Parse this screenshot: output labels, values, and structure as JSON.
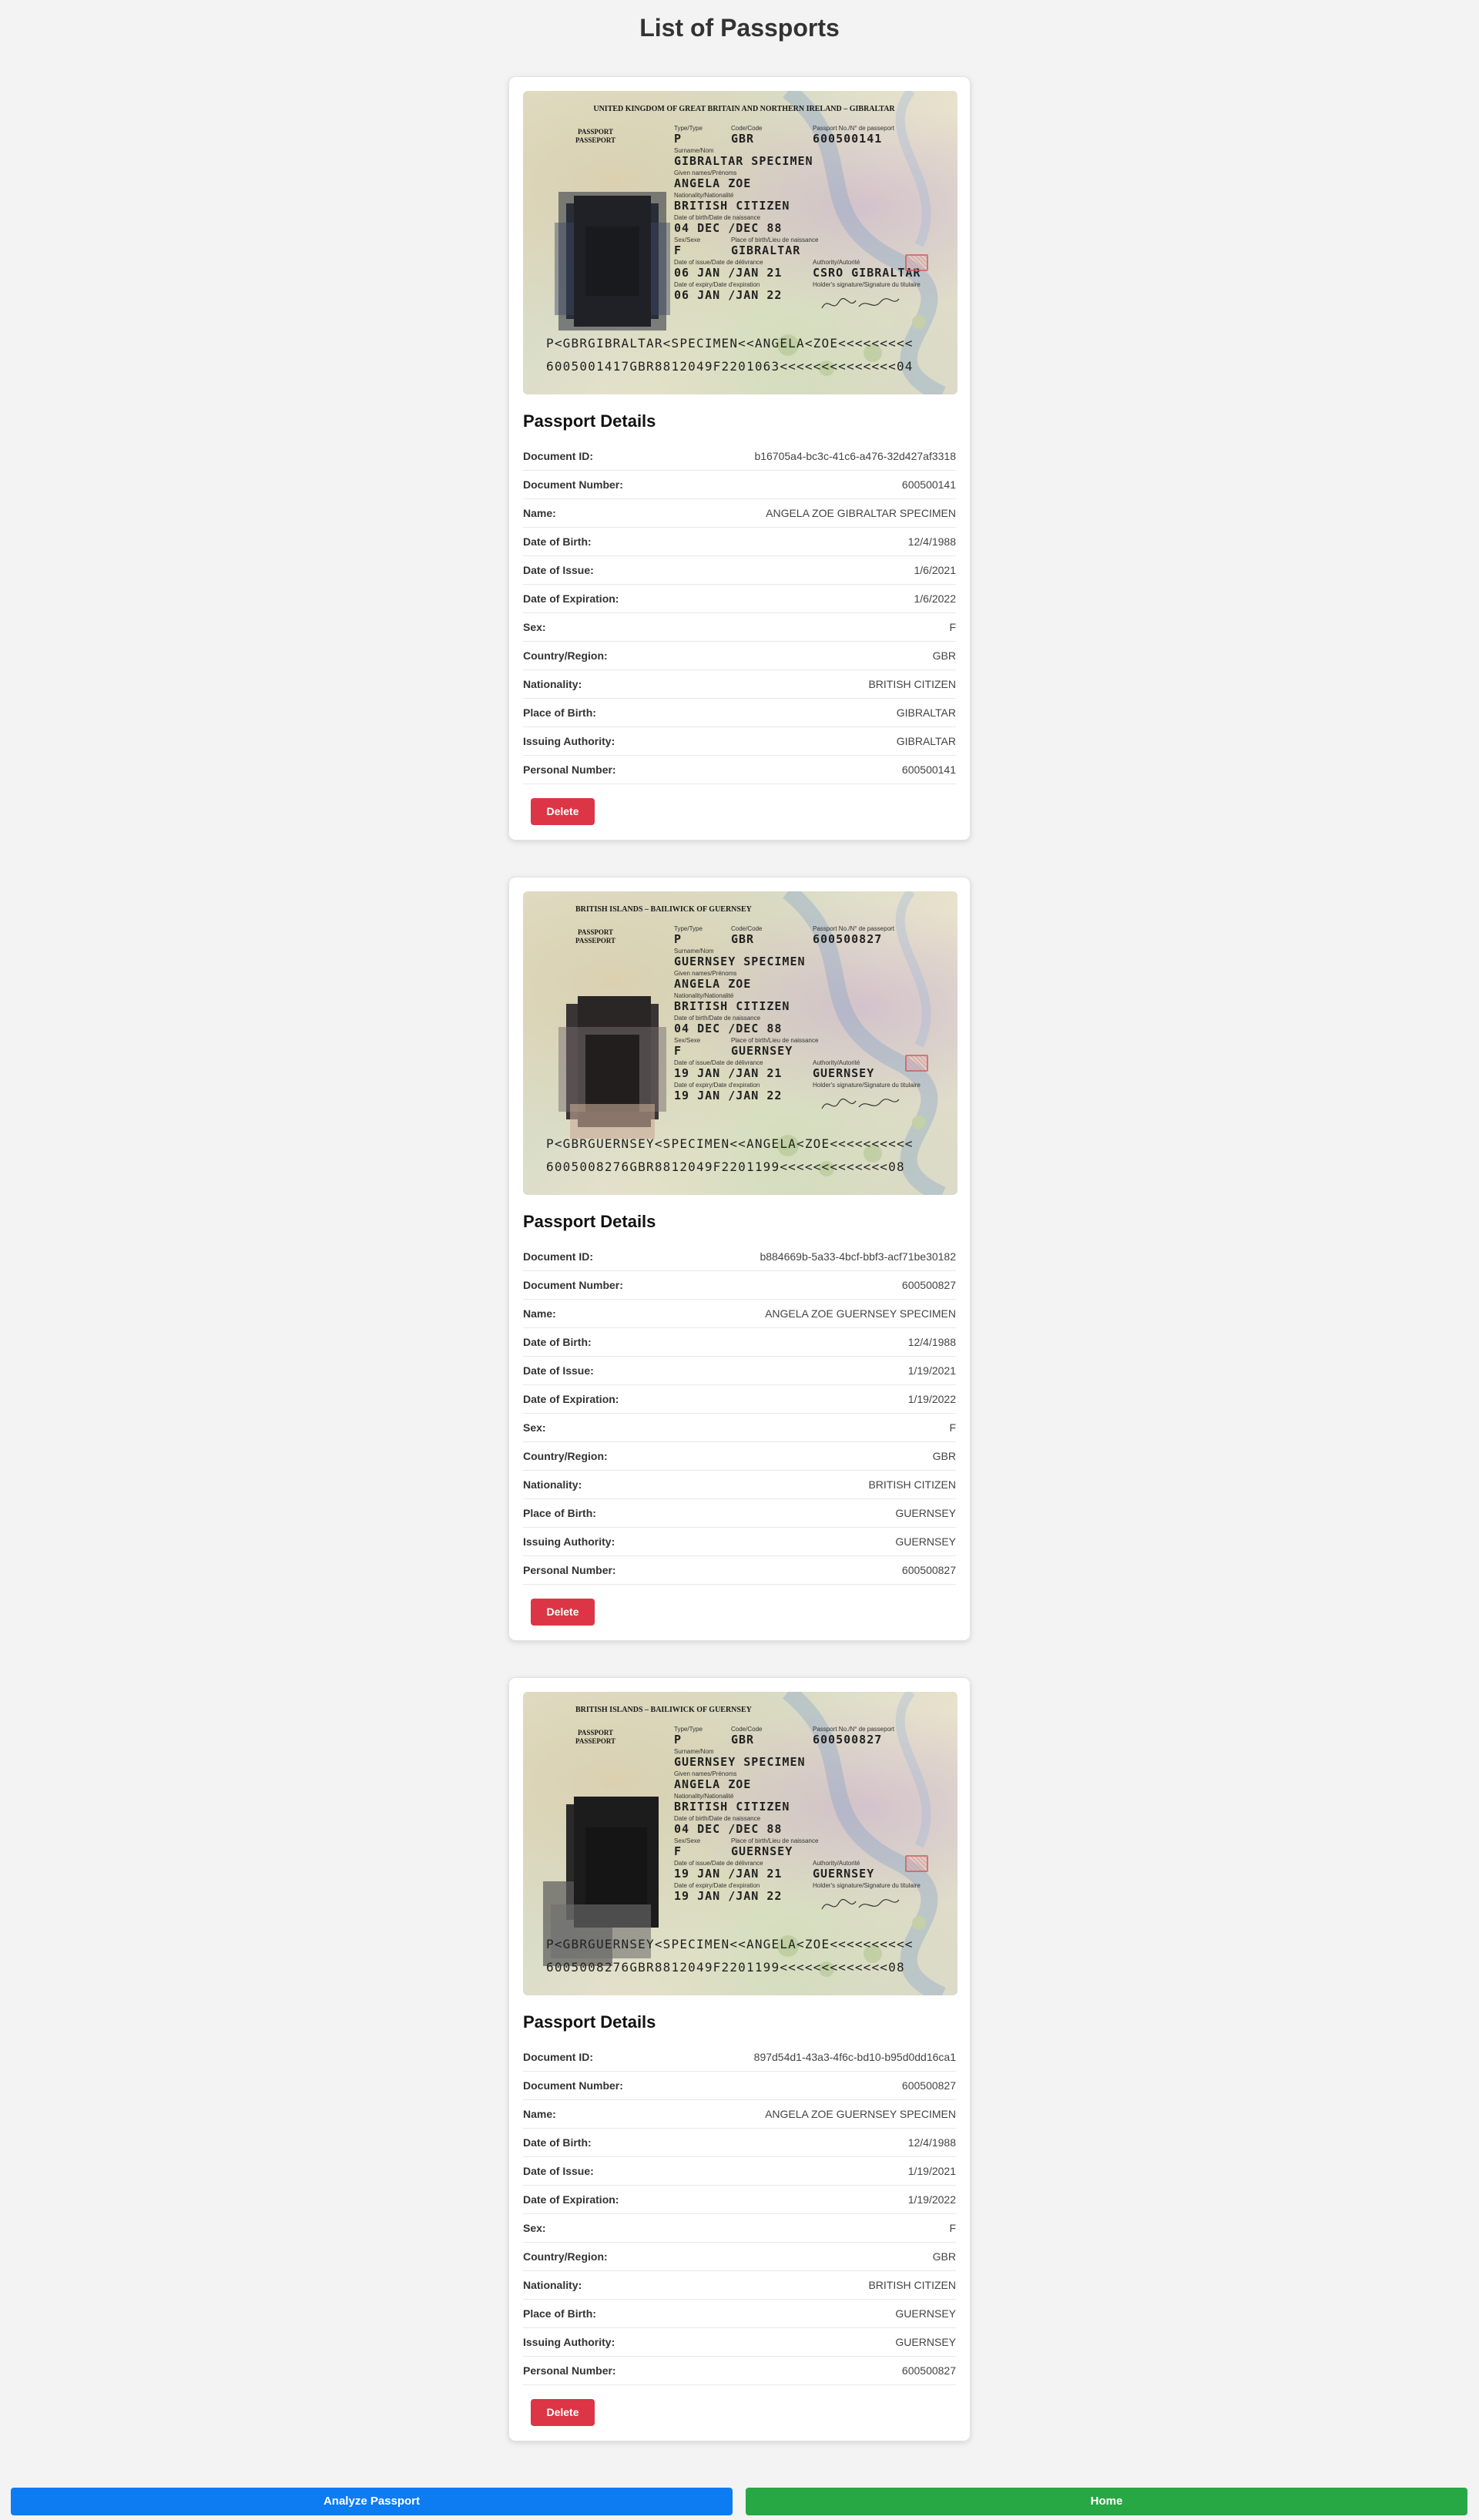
{
  "page": {
    "title": "List of Passports"
  },
  "labels": {
    "details_title": "Passport Details",
    "document_id": "Document ID:",
    "document_number": "Document Number:",
    "name": "Name:",
    "dob": "Date of Birth:",
    "doi": "Date of Issue:",
    "doe": "Date of Expiration:",
    "sex": "Sex:",
    "country": "Country/Region:",
    "nationality": "Nationality:",
    "pob": "Place of Birth:",
    "authority": "Issuing Authority:",
    "personal_number": "Personal Number:",
    "delete": "Delete"
  },
  "image_labels": {
    "passport": "PASSPORT",
    "passeport": "PASSEPORT",
    "type": "Type/Type",
    "code": "Code/Code",
    "passport_no": "Passport No./N° de passeport",
    "surname": "Surname/Nom",
    "given": "Given names/Prénoms",
    "nationality": "Nationality/Nationalité",
    "dob": "Date of birth/Date de naissance",
    "sex": "Sex/Sexe",
    "pob": "Place of birth/Lieu de naissance",
    "doi": "Date of issue/Date de délivrance",
    "authority": "Authority/Autorité",
    "doe": "Date of expiry/Date d'expiration",
    "holder_sig": "Holder's signature/Signature du titulaire"
  },
  "passports": [
    {
      "image": {
        "header": "UNITED KINGDOM OF GREAT BRITAIN AND NORTHERN IRELAND – GIBRALTAR",
        "type": "P",
        "code": "GBR",
        "number": "600500141",
        "surname": "GIBRALTAR SPECIMEN",
        "given": "ANGELA ZOE",
        "nationality": "BRITISH CITIZEN",
        "dob": "04 DEC /DEC  88",
        "sex": "F",
        "pob": "GIBRALTAR",
        "doi": "06 JAN /JAN  21",
        "authority": "CSRO GIBRALTAR",
        "doe": "06 JAN /JAN  22",
        "mrz1": "P<GBRGIBRALTAR<SPECIMEN<<ANGELA<ZOE<<<<<<<<<",
        "mrz2": "6005001417GBR8812049F2201063<<<<<<<<<<<<<<04"
      },
      "details": {
        "document_id": "b16705a4-bc3c-41c6-a476-32d427af3318",
        "document_number": "600500141",
        "name": "ANGELA ZOE GIBRALTAR SPECIMEN",
        "dob": "12/4/1988",
        "doi": "1/6/2021",
        "doe": "1/6/2022",
        "sex": "F",
        "country": "GBR",
        "nationality": "BRITISH CITIZEN",
        "pob": "GIBRALTAR",
        "authority": "GIBRALTAR",
        "personal_number": "600500141"
      }
    },
    {
      "image": {
        "header": "BRITISH ISLANDS – BAILIWICK OF GUERNSEY",
        "type": "P",
        "code": "GBR",
        "number": "600500827",
        "surname": "GUERNSEY SPECIMEN",
        "given": "ANGELA ZOE",
        "nationality": "BRITISH CITIZEN",
        "dob": "04 DEC /DEC  88",
        "sex": "F",
        "pob": "GUERNSEY",
        "doi": "19 JAN /JAN  21",
        "authority": "GUERNSEY",
        "doe": "19 JAN /JAN  22",
        "mrz1": "P<GBRGUERNSEY<SPECIMEN<<ANGELA<ZOE<<<<<<<<<<",
        "mrz2": "6005008276GBR8812049F2201199<<<<<<<<<<<<<08"
      },
      "details": {
        "document_id": "b884669b-5a33-4bcf-bbf3-acf71be30182",
        "document_number": "600500827",
        "name": "ANGELA ZOE GUERNSEY SPECIMEN",
        "dob": "12/4/1988",
        "doi": "1/19/2021",
        "doe": "1/19/2022",
        "sex": "F",
        "country": "GBR",
        "nationality": "BRITISH CITIZEN",
        "pob": "GUERNSEY",
        "authority": "GUERNSEY",
        "personal_number": "600500827"
      }
    },
    {
      "image": {
        "header": "BRITISH ISLANDS – BAILIWICK OF GUERNSEY",
        "type": "P",
        "code": "GBR",
        "number": "600500827",
        "surname": "GUERNSEY SPECIMEN",
        "given": "ANGELA ZOE",
        "nationality": "BRITISH CITIZEN",
        "dob": "04 DEC /DEC  88",
        "sex": "F",
        "pob": "GUERNSEY",
        "doi": "19 JAN /JAN  21",
        "authority": "GUERNSEY",
        "doe": "19 JAN /JAN  22",
        "mrz1": "P<GBRGUERNSEY<SPECIMEN<<ANGELA<ZOE<<<<<<<<<<",
        "mrz2": "6005008276GBR8812049F2201199<<<<<<<<<<<<<08"
      },
      "details": {
        "document_id": "897d54d1-43a3-4f6c-bd10-b95d0dd16ca1",
        "document_number": "600500827",
        "name": "ANGELA ZOE GUERNSEY SPECIMEN",
        "dob": "12/4/1988",
        "doi": "1/19/2021",
        "doe": "1/19/2022",
        "sex": "F",
        "country": "GBR",
        "nationality": "BRITISH CITIZEN",
        "pob": "GUERNSEY",
        "authority": "GUERNSEY",
        "personal_number": "600500827"
      }
    }
  ],
  "buttons": {
    "analyze": "Analyze Passport",
    "home": "Home"
  },
  "colors": {
    "delete": "#dc3545",
    "analyze": "#0d7bf2",
    "home": "#28a745"
  }
}
